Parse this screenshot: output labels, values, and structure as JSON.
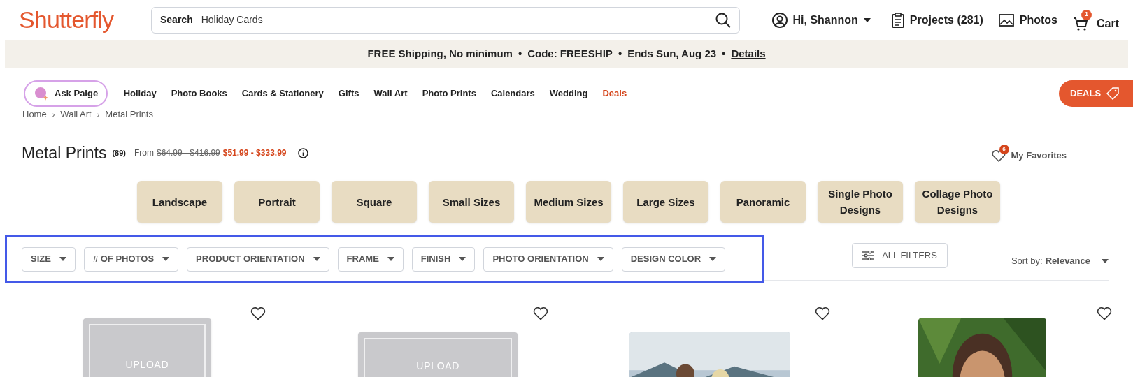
{
  "header": {
    "logo": "Shutterfly",
    "search": {
      "label": "Search",
      "value": "Holiday Cards"
    },
    "account": "Hi, Shannon",
    "projects": "Projects (281)",
    "photos": "Photos",
    "cart": {
      "label": "Cart",
      "badge": "1"
    }
  },
  "promo": {
    "parts": [
      "FREE Shipping, No minimum",
      "Code: FREESHIP",
      "Ends Sun, Aug 23"
    ],
    "link": "Details",
    "separator": "•"
  },
  "nav": {
    "ask": "Ask Paige",
    "items": [
      {
        "label": "Holiday",
        "kind": "plain"
      },
      {
        "label": "Photo Books",
        "kind": "plain"
      },
      {
        "label": "Cards & Stationery",
        "kind": "plain"
      },
      {
        "label": "Gifts",
        "kind": "plain"
      },
      {
        "label": "Wall Art",
        "kind": "plain"
      },
      {
        "label": "Photo Prints",
        "kind": "plain"
      },
      {
        "label": "Calendars",
        "kind": "plain"
      },
      {
        "label": "Wedding",
        "kind": "plain"
      },
      {
        "label": "Deals",
        "kind": "deal"
      }
    ],
    "deals_button": "DEALS"
  },
  "breadcrumb": {
    "separator": "›",
    "items": [
      "Home",
      "Wall Art",
      "Metal Prints"
    ]
  },
  "title": {
    "text": "Metal Prints",
    "count": "(89)",
    "from": "From",
    "old_price": "$64.99 - $416.99",
    "price": "$51.99 - $333.99"
  },
  "favorites": {
    "label": "My Favorites",
    "badge": "6"
  },
  "categories": [
    "Landscape",
    "Portrait",
    "Square",
    "Small Sizes",
    "Medium Sizes",
    "Large Sizes",
    "Panoramic",
    "Single Photo Designs",
    "Collage Photo Designs"
  ],
  "filters": {
    "highlighted": true,
    "items": [
      "SIZE",
      "# OF PHOTOS",
      "PRODUCT ORIENTATION",
      "FRAME",
      "FINISH",
      "PHOTO ORIENTATION",
      "DESIGN COLOR"
    ]
  },
  "all_filters": "ALL FILTERS",
  "sort": {
    "label": "Sort by:",
    "value": "Relevance"
  },
  "products": [
    {
      "kind": "upload",
      "text": "UPLOAD",
      "favorite": false
    },
    {
      "kind": "upload",
      "text": "UPLOAD",
      "favorite": false
    },
    {
      "kind": "picture",
      "favorite": false
    },
    {
      "kind": "picture",
      "favorite": false
    }
  ]
}
